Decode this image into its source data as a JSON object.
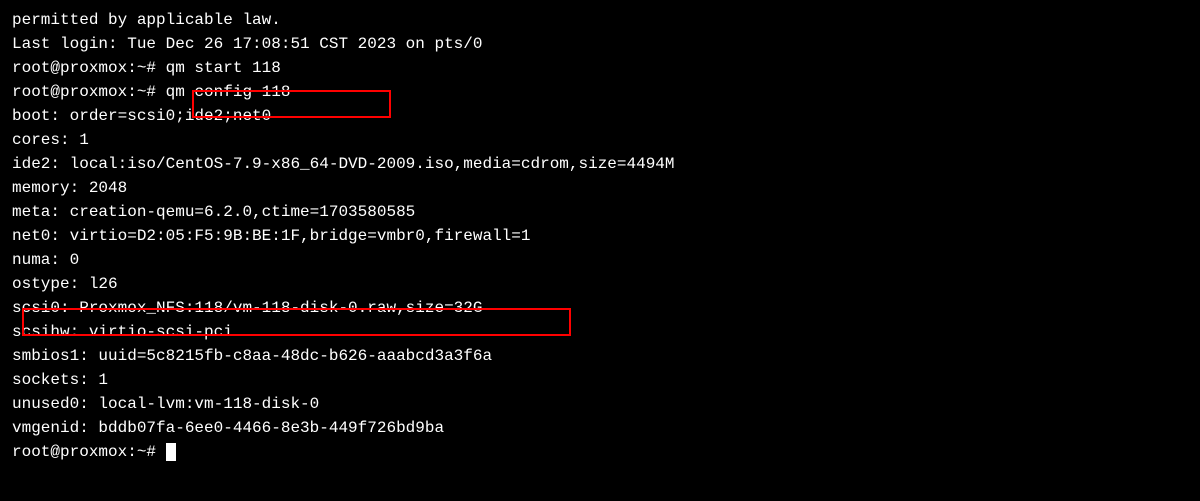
{
  "lines": {
    "l0": "permitted by applicable law.",
    "l1": "Last login: Tue Dec 26 17:08:51 CST 2023 on pts/0",
    "l2": "root@proxmox:~# qm start 118",
    "l3": "root@proxmox:~# qm config 118",
    "l4": "boot: order=scsi0;ide2;net0",
    "l5": "cores: 1",
    "l6": "ide2: local:iso/CentOS-7.9-x86_64-DVD-2009.iso,media=cdrom,size=4494M",
    "l7": "memory: 2048",
    "l8": "meta: creation-qemu=6.2.0,ctime=1703580585",
    "l9": "net0: virtio=D2:05:F5:9B:BE:1F,bridge=vmbr0,firewall=1",
    "l10": "numa: 0",
    "l11": "ostype: l26",
    "l12": "scsi0: Proxmox_NFS:118/vm-118-disk-0.raw,size=32G",
    "l13": "scsihw: virtio-scsi-pci",
    "l14": "smbios1: uuid=5c8215fb-c8aa-48dc-b626-aaabcd3a3f6a",
    "l15": "sockets: 1",
    "l16": "unused0: local-lvm:vm-118-disk-0",
    "l17": "vmgenid: bddb07fa-6ee0-4466-8e3b-449f726bd9ba",
    "l18": "root@proxmox:~# "
  }
}
